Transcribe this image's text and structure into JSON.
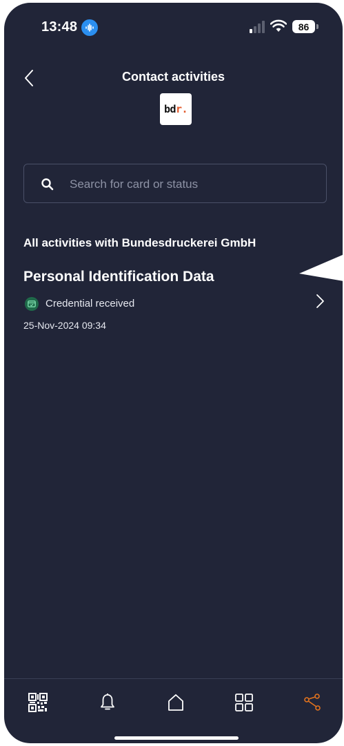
{
  "status_bar": {
    "time": "13:48",
    "battery": "86",
    "icons": [
      "audio-recording-icon",
      "cellular-signal-icon",
      "wifi-icon",
      "battery-icon"
    ]
  },
  "header": {
    "title": "Contact activities",
    "back_icon": "chevron-left-icon",
    "logo_text_main": "bd",
    "logo_text_accent": "r."
  },
  "search": {
    "placeholder": "Search for card or status",
    "value": "",
    "icon": "search-icon"
  },
  "section": {
    "heading": "All activities with Bundesdruckerei GmbH"
  },
  "activities": [
    {
      "title": "Personal Identification Data",
      "status": "Credential received",
      "status_icon": "credential-card-icon",
      "date": "25-Nov-2024 09:34",
      "status_color": "#1f6a4a"
    }
  ],
  "nav": {
    "items": [
      "qr-code-icon",
      "bell-icon",
      "home-icon",
      "grid-icon",
      "connections-icon"
    ],
    "active": "connections-icon",
    "active_color": "#e2731e",
    "inactive_color": "#ffffff"
  },
  "colors": {
    "background": "#212538",
    "search_border": "#4a5068",
    "placeholder": "#8d92a5"
  }
}
